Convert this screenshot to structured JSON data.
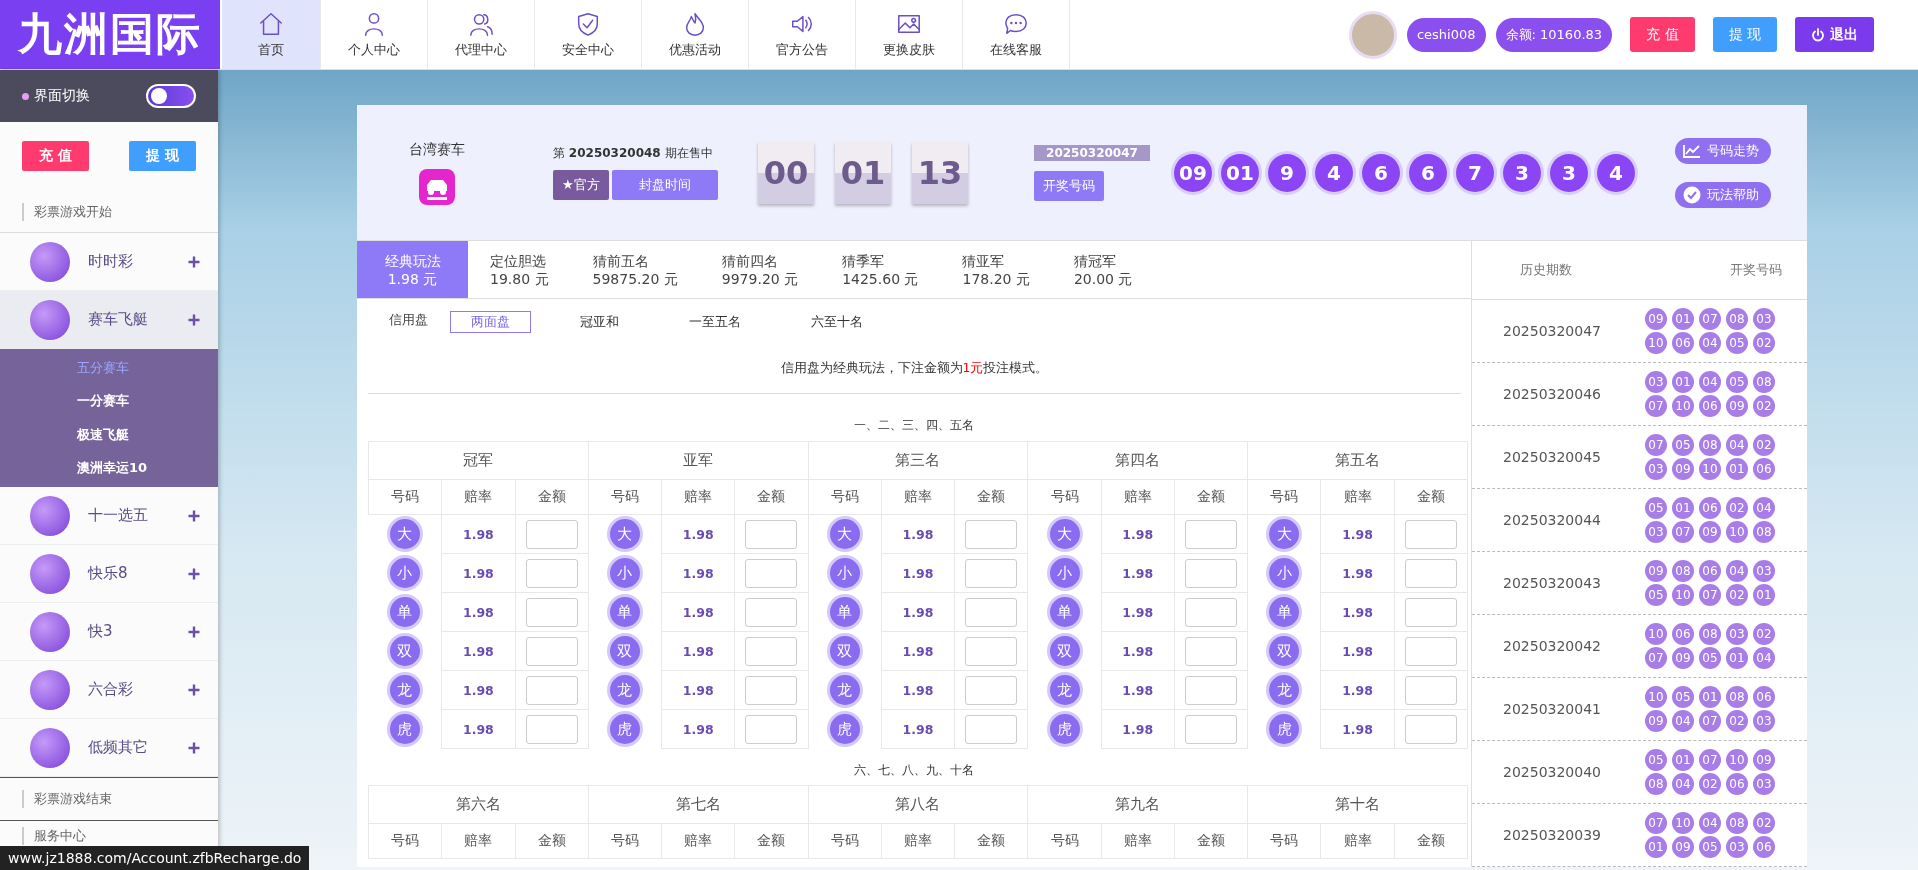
{
  "logo": "九洲国际",
  "nav": [
    {
      "label": "首页",
      "kind": "home",
      "selected": true
    },
    {
      "label": "个人中心",
      "kind": "person",
      "selected": false
    },
    {
      "label": "代理中心",
      "kind": "people",
      "selected": false
    },
    {
      "label": "安全中心",
      "kind": "shield",
      "selected": false
    },
    {
      "label": "优惠活动",
      "kind": "flame",
      "selected": false
    },
    {
      "label": "官方公告",
      "kind": "speaker",
      "selected": false
    },
    {
      "label": "更换皮肤",
      "kind": "picture",
      "selected": false
    },
    {
      "label": "在线客服",
      "kind": "chat",
      "selected": false
    }
  ],
  "user": {
    "name": "ceshi008",
    "balance": "余额: 10160.83"
  },
  "top_buttons": [
    {
      "label": "充 值",
      "kind": "recharge"
    },
    {
      "label": "提 现",
      "kind": "withdraw"
    },
    {
      "label": "退出",
      "kind": "logout"
    }
  ],
  "sidebar": {
    "switch_label": "界面切换",
    "switch_on": false,
    "buttons": [
      {
        "label": "充 值",
        "kind": "recharge"
      },
      {
        "label": "提 现",
        "kind": "withdraw"
      }
    ],
    "section_start": "彩票游戏开始",
    "games": [
      {
        "name": "时时彩",
        "expanded": false
      },
      {
        "name": "赛车飞艇",
        "expanded": true,
        "children": [
          {
            "name": "五分赛车",
            "selected": true
          },
          {
            "name": "一分赛车",
            "selected": false
          },
          {
            "name": "极速飞艇",
            "selected": false
          },
          {
            "name": "澳洲幸运10",
            "selected": false
          }
        ]
      },
      {
        "name": "十一选五",
        "expanded": false
      },
      {
        "name": "快乐8",
        "expanded": false
      },
      {
        "name": "快3",
        "expanded": false
      },
      {
        "name": "六合彩",
        "expanded": false
      },
      {
        "name": "低频其它",
        "expanded": false
      }
    ],
    "section_end": "彩票游戏结束",
    "section_service": "服务中心"
  },
  "status_url": "www.jz1888.com/Account.zfbRecharge.do",
  "game_header": {
    "name": "台湾赛车",
    "issue": "第 **20250320048** 期在售中",
    "buttons": [
      {
        "label": "★官方",
        "kind": "official"
      },
      {
        "label": "封盘时间",
        "kind": "close_time"
      }
    ],
    "countdown": [
      "00",
      "01",
      "13"
    ],
    "last_issue": "20250320047",
    "draw_button": "开奖号码",
    "balls": [
      "09",
      "01",
      "9",
      "4",
      "6",
      "6",
      "7",
      "3",
      "3",
      "4"
    ],
    "links": [
      {
        "label": "号码走势",
        "kind": "trend"
      },
      {
        "label": "玩法帮助",
        "kind": "help"
      }
    ]
  },
  "play_tabs": [
    {
      "name": "经典玩法",
      "price": "1.98 元",
      "selected": true
    },
    {
      "name": "定位胆选",
      "price": "19.80 元",
      "selected": false
    },
    {
      "name": "猜前五名",
      "price": "59875.20 元",
      "selected": false
    },
    {
      "name": "猜前四名",
      "price": "9979.20 元",
      "selected": false
    },
    {
      "name": "猜季军",
      "price": "1425.60 元",
      "selected": false
    },
    {
      "name": "猜亚军",
      "price": "178.20 元",
      "selected": false
    },
    {
      "name": "猜冠军",
      "price": "20.00 元",
      "selected": false
    }
  ],
  "mode_label": "信用盘",
  "sub_tabs": [
    {
      "label": "两面盘",
      "selected": true
    },
    {
      "label": "冠亚和",
      "selected": false
    },
    {
      "label": "一至五名",
      "selected": false
    },
    {
      "label": "六至十名",
      "selected": false
    }
  ],
  "notice": {
    "before": "信用盘为经典玩法，下注金额为",
    "highlight": "1元",
    "after": "投注模式。"
  },
  "sections": [
    {
      "title": "一、二、三、四、五名",
      "groups": [
        {
          "name": "冠军",
          "columns": [
            "号码",
            "赔率",
            "金额"
          ],
          "rows": [
            {
              "label": "大",
              "odds": "1.98"
            },
            {
              "label": "小",
              "odds": "1.98"
            },
            {
              "label": "单",
              "odds": "1.98"
            },
            {
              "label": "双",
              "odds": "1.98"
            },
            {
              "label": "龙",
              "odds": "1.98"
            },
            {
              "label": "虎",
              "odds": "1.98"
            }
          ]
        },
        {
          "name": "亚军",
          "columns": [
            "号码",
            "赔率",
            "金额"
          ],
          "rows": [
            {
              "label": "大",
              "odds": "1.98"
            },
            {
              "label": "小",
              "odds": "1.98"
            },
            {
              "label": "单",
              "odds": "1.98"
            },
            {
              "label": "双",
              "odds": "1.98"
            },
            {
              "label": "龙",
              "odds": "1.98"
            },
            {
              "label": "虎",
              "odds": "1.98"
            }
          ]
        },
        {
          "name": "第三名",
          "columns": [
            "号码",
            "赔率",
            "金额"
          ],
          "rows": [
            {
              "label": "大",
              "odds": "1.98"
            },
            {
              "label": "小",
              "odds": "1.98"
            },
            {
              "label": "单",
              "odds": "1.98"
            },
            {
              "label": "双",
              "odds": "1.98"
            },
            {
              "label": "龙",
              "odds": "1.98"
            },
            {
              "label": "虎",
              "odds": "1.98"
            }
          ]
        },
        {
          "name": "第四名",
          "columns": [
            "号码",
            "赔率",
            "金额"
          ],
          "rows": [
            {
              "label": "大",
              "odds": "1.98"
            },
            {
              "label": "小",
              "odds": "1.98"
            },
            {
              "label": "单",
              "odds": "1.98"
            },
            {
              "label": "双",
              "odds": "1.98"
            },
            {
              "label": "龙",
              "odds": "1.98"
            },
            {
              "label": "虎",
              "odds": "1.98"
            }
          ]
        },
        {
          "name": "第五名",
          "columns": [
            "号码",
            "赔率",
            "金额"
          ],
          "rows": [
            {
              "label": "大",
              "odds": "1.98"
            },
            {
              "label": "小",
              "odds": "1.98"
            },
            {
              "label": "单",
              "odds": "1.98"
            },
            {
              "label": "双",
              "odds": "1.98"
            },
            {
              "label": "龙",
              "odds": "1.98"
            },
            {
              "label": "虎",
              "odds": "1.98"
            }
          ]
        }
      ]
    },
    {
      "title": "六、七、八、九、十名",
      "groups": [
        {
          "name": "第六名",
          "columns": [
            "号码",
            "赔率",
            "金额"
          ]
        },
        {
          "name": "第七名",
          "columns": [
            "号码",
            "赔率",
            "金额"
          ]
        },
        {
          "name": "第八名",
          "columns": [
            "号码",
            "赔率",
            "金额"
          ]
        },
        {
          "name": "第九名",
          "columns": [
            "号码",
            "赔率",
            "金额"
          ]
        },
        {
          "name": "第十名",
          "columns": [
            "号码",
            "赔率",
            "金额"
          ]
        }
      ]
    }
  ],
  "history": {
    "columns": [
      "历史期数",
      "开奖号码"
    ],
    "rows": [
      {
        "issue": "20250320047",
        "numbers": [
          "09",
          "01",
          "07",
          "08",
          "03",
          "10",
          "06",
          "04",
          "05",
          "02"
        ]
      },
      {
        "issue": "20250320046",
        "numbers": [
          "03",
          "01",
          "04",
          "05",
          "08",
          "07",
          "10",
          "06",
          "09",
          "02"
        ]
      },
      {
        "issue": "20250320045",
        "numbers": [
          "07",
          "05",
          "08",
          "04",
          "02",
          "03",
          "09",
          "10",
          "01",
          "06"
        ]
      },
      {
        "issue": "20250320044",
        "numbers": [
          "05",
          "01",
          "06",
          "02",
          "04",
          "03",
          "07",
          "09",
          "10",
          "08"
        ]
      },
      {
        "issue": "20250320043",
        "numbers": [
          "09",
          "08",
          "06",
          "04",
          "03",
          "05",
          "10",
          "07",
          "02",
          "01"
        ]
      },
      {
        "issue": "20250320042",
        "numbers": [
          "10",
          "06",
          "08",
          "03",
          "02",
          "07",
          "09",
          "05",
          "01",
          "04"
        ]
      },
      {
        "issue": "20250320041",
        "numbers": [
          "10",
          "05",
          "01",
          "08",
          "06",
          "09",
          "04",
          "07",
          "02",
          "03"
        ]
      },
      {
        "issue": "20250320040",
        "numbers": [
          "05",
          "01",
          "07",
          "10",
          "09",
          "08",
          "04",
          "02",
          "06",
          "03"
        ]
      },
      {
        "issue": "20250320039",
        "numbers": [
          "07",
          "10",
          "04",
          "08",
          "02",
          "01",
          "09",
          "05",
          "03",
          "06"
        ]
      }
    ]
  }
}
